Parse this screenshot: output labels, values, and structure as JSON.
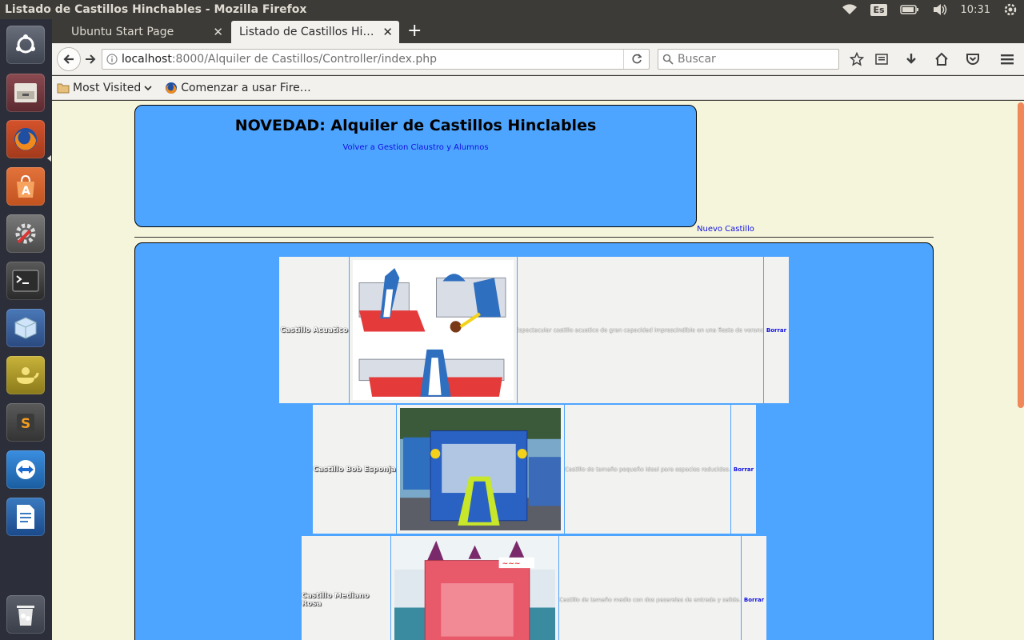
{
  "window": {
    "title": "Listado de Castillos Hinchables - Mozilla Firefox",
    "keyboard_layout": "Es",
    "clock": "10:31"
  },
  "tabs": [
    {
      "label": "Ubuntu Start Page",
      "active": false
    },
    {
      "label": "Listado de Castillos Hi…",
      "active": true
    }
  ],
  "url": {
    "host": "localhost",
    "rest": ":8000/Alquiler de Castillos/Controller/index.php"
  },
  "search": {
    "placeholder": "Buscar"
  },
  "bookmarks": [
    {
      "label": "Most Visited",
      "icon": "folder-icon"
    },
    {
      "label": "Comenzar a usar Fire…",
      "icon": "firefox-icon"
    }
  ],
  "page": {
    "header_title": "NOVEDAD: Alquiler de Castillos Hinclables",
    "back_link": "Volver a Gestion Claustro y Alumnos",
    "new_link": "Nuevo Castillo",
    "castles": [
      {
        "name": "Castillo Acuatico",
        "description": "Espectacular castillo acuatico de gran capacidad imprescindible en una fiesta de verano.",
        "delete_label": "Borrar"
      },
      {
        "name": "Castillo Bob Esponja",
        "description": "Castillo de tamaño pequeño ideal para espacios reducidos.",
        "delete_label": "Borrar"
      },
      {
        "name": "Castillo Mediano Rosa",
        "description": "Castillo de tamaño medio con dos pasarelas de entrada y salida.",
        "delete_label": "Borrar"
      }
    ]
  },
  "colors": {
    "panel_bg": "#3c3b37",
    "launcher_bg": "#2c2f3a",
    "page_bg": "#f5f5dc",
    "box_blue": "#4ea5ff",
    "scroll_thumb": "#f0885a"
  }
}
